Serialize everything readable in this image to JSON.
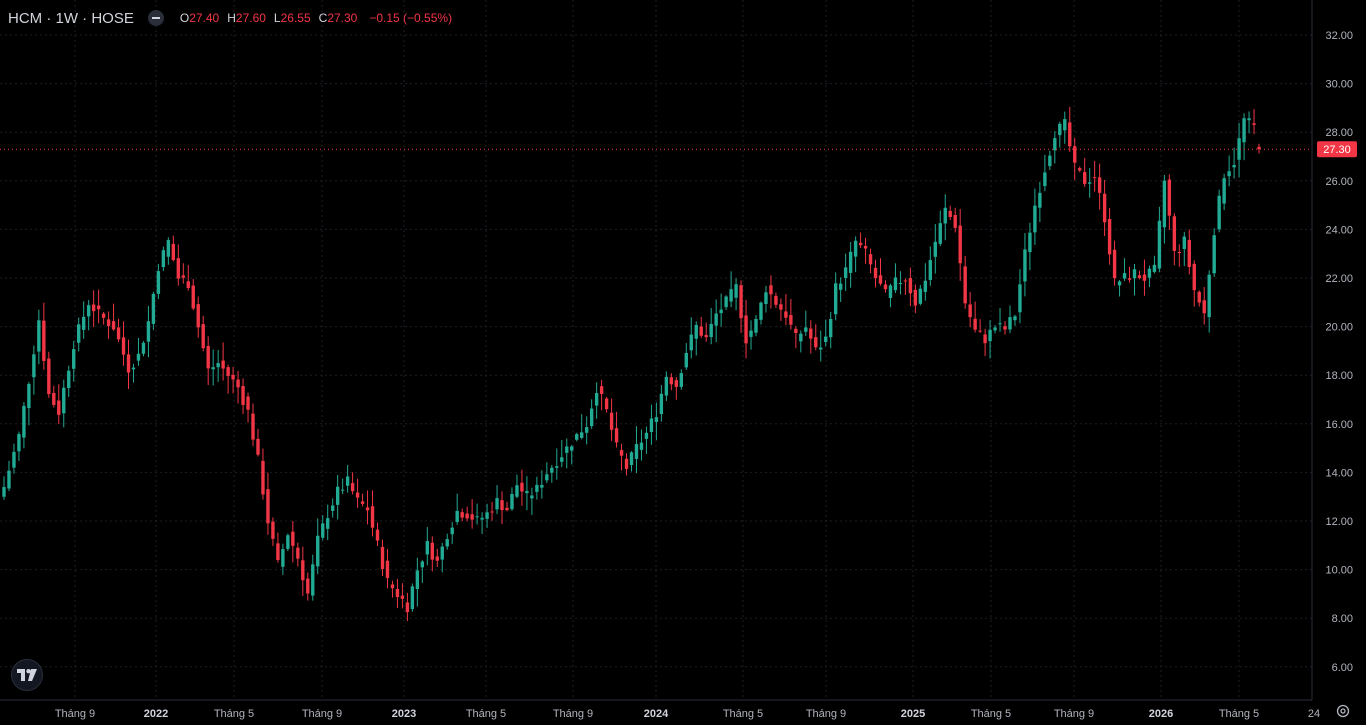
{
  "header": {
    "symbol": "HCM · 1W · HOSE",
    "open_label": "O",
    "open": "27.40",
    "high_label": "H",
    "high": "27.60",
    "low_label": "L",
    "low": "26.55",
    "close_label": "C",
    "close": "27.30",
    "change": "−0.15 (−0.55%)"
  },
  "colors": {
    "up": "#22ab94",
    "down": "#f23645",
    "background": "#000000",
    "grid": "#1c1f26",
    "axis_text": "#b2b5be"
  },
  "chart_data": {
    "type": "candlestick",
    "symbol": "HCM",
    "interval": "1W",
    "exchange": "HOSE",
    "y_axis": {
      "side": "right",
      "range": [
        5.5,
        33.0
      ],
      "ticks": [
        "32.00",
        "30.00",
        "28.00",
        "26.00",
        "24.00",
        "22.00",
        "20.00",
        "18.00",
        "16.00",
        "14.00",
        "12.00",
        "10.00",
        "8.00",
        "6.00"
      ]
    },
    "x_axis": {
      "ticks": [
        {
          "label": "Tháng 9",
          "bold": false
        },
        {
          "label": "2022",
          "bold": true
        },
        {
          "label": "Tháng 5",
          "bold": false
        },
        {
          "label": "Tháng 9",
          "bold": false
        },
        {
          "label": "2023",
          "bold": true
        },
        {
          "label": "Tháng 5",
          "bold": false
        },
        {
          "label": "Tháng 9",
          "bold": false
        },
        {
          "label": "2024",
          "bold": true
        },
        {
          "label": "Tháng 5",
          "bold": false
        },
        {
          "label": "Tháng 9",
          "bold": false
        },
        {
          "label": "2025",
          "bold": true
        },
        {
          "label": "Tháng 5",
          "bold": false
        },
        {
          "label": "Tháng 9",
          "bold": false
        },
        {
          "label": "2026",
          "bold": true
        },
        {
          "label": "Tháng 5",
          "bold": false
        },
        {
          "label": "24",
          "bold": false
        }
      ]
    },
    "last_price": {
      "value": 27.3,
      "label": "27.30"
    },
    "anchors": [
      [
        0,
        13.4
      ],
      [
        3,
        15.5
      ],
      [
        5,
        17.8
      ],
      [
        7,
        20.3
      ],
      [
        9,
        17.2
      ],
      [
        11,
        16.5
      ],
      [
        14,
        19.3
      ],
      [
        17,
        21.0
      ],
      [
        19,
        20.5
      ],
      [
        22,
        20.0
      ],
      [
        25,
        18.3
      ],
      [
        27,
        18.8
      ],
      [
        29,
        20.2
      ],
      [
        31,
        22.5
      ],
      [
        33,
        23.5
      ],
      [
        35,
        22.0
      ],
      [
        37,
        21.8
      ],
      [
        39,
        20.0
      ],
      [
        41,
        18.2
      ],
      [
        43,
        18.5
      ],
      [
        45,
        18.0
      ],
      [
        47,
        17.5
      ],
      [
        49,
        16.5
      ],
      [
        51,
        14.5
      ],
      [
        53,
        12.0
      ],
      [
        55,
        10.2
      ],
      [
        57,
        11.5
      ],
      [
        59,
        10.5
      ],
      [
        61,
        9.0
      ],
      [
        63,
        11.2
      ],
      [
        65,
        12.3
      ],
      [
        67,
        13.2
      ],
      [
        69,
        13.6
      ],
      [
        71,
        12.8
      ],
      [
        73,
        12.5
      ],
      [
        75,
        11.0
      ],
      [
        77,
        9.5
      ],
      [
        79,
        9.0
      ],
      [
        81,
        8.5
      ],
      [
        83,
        10.0
      ],
      [
        85,
        11.0
      ],
      [
        87,
        10.3
      ],
      [
        89,
        11.5
      ],
      [
        91,
        12.4
      ],
      [
        93,
        12.3
      ],
      [
        95,
        12.0
      ],
      [
        97,
        12.3
      ],
      [
        99,
        12.8
      ],
      [
        101,
        12.5
      ],
      [
        103,
        13.5
      ],
      [
        105,
        13.0
      ],
      [
        107,
        13.3
      ],
      [
        109,
        14.0
      ],
      [
        111,
        14.5
      ],
      [
        113,
        15.0
      ],
      [
        115,
        15.5
      ],
      [
        117,
        16.0
      ],
      [
        119,
        17.5
      ],
      [
        121,
        16.5
      ],
      [
        123,
        15.0
      ],
      [
        125,
        14.2
      ],
      [
        127,
        15.0
      ],
      [
        129,
        15.6
      ],
      [
        131,
        16.5
      ],
      [
        133,
        18.0
      ],
      [
        135,
        17.6
      ],
      [
        137,
        19.0
      ],
      [
        139,
        20.0
      ],
      [
        141,
        19.5
      ],
      [
        143,
        20.5
      ],
      [
        145,
        21.0
      ],
      [
        147,
        21.6
      ],
      [
        149,
        19.5
      ],
      [
        151,
        20.2
      ],
      [
        153,
        21.6
      ],
      [
        155,
        21.0
      ],
      [
        157,
        20.5
      ],
      [
        159,
        19.5
      ],
      [
        161,
        20.0
      ],
      [
        163,
        19.0
      ],
      [
        165,
        19.5
      ],
      [
        167,
        21.6
      ],
      [
        169,
        22.3
      ],
      [
        171,
        23.5
      ],
      [
        173,
        23.0
      ],
      [
        175,
        22.0
      ],
      [
        177,
        21.3
      ],
      [
        179,
        21.8
      ],
      [
        181,
        22.0
      ],
      [
        183,
        21.0
      ],
      [
        185,
        22.0
      ],
      [
        187,
        23.5
      ],
      [
        189,
        24.8
      ],
      [
        191,
        24.2
      ],
      [
        193,
        21.0
      ],
      [
        195,
        19.8
      ],
      [
        197,
        19.5
      ],
      [
        199,
        20.0
      ],
      [
        201,
        19.9
      ],
      [
        203,
        20.5
      ],
      [
        205,
        23.0
      ],
      [
        207,
        25.0
      ],
      [
        209,
        26.5
      ],
      [
        211,
        28.0
      ],
      [
        213,
        28.3
      ],
      [
        215,
        26.5
      ],
      [
        217,
        26.0
      ],
      [
        219,
        26.2
      ],
      [
        221,
        24.5
      ],
      [
        223,
        21.8
      ],
      [
        225,
        22.0
      ],
      [
        227,
        22.2
      ],
      [
        229,
        22.0
      ],
      [
        231,
        22.3
      ],
      [
        233,
        26.0
      ],
      [
        235,
        23.0
      ],
      [
        237,
        23.5
      ],
      [
        239,
        21.5
      ],
      [
        241,
        20.5
      ],
      [
        243,
        24.0
      ],
      [
        245,
        26.3
      ],
      [
        247,
        26.8
      ],
      [
        249,
        28.5
      ],
      [
        251,
        28.2
      ],
      [
        252,
        27.3
      ]
    ]
  }
}
